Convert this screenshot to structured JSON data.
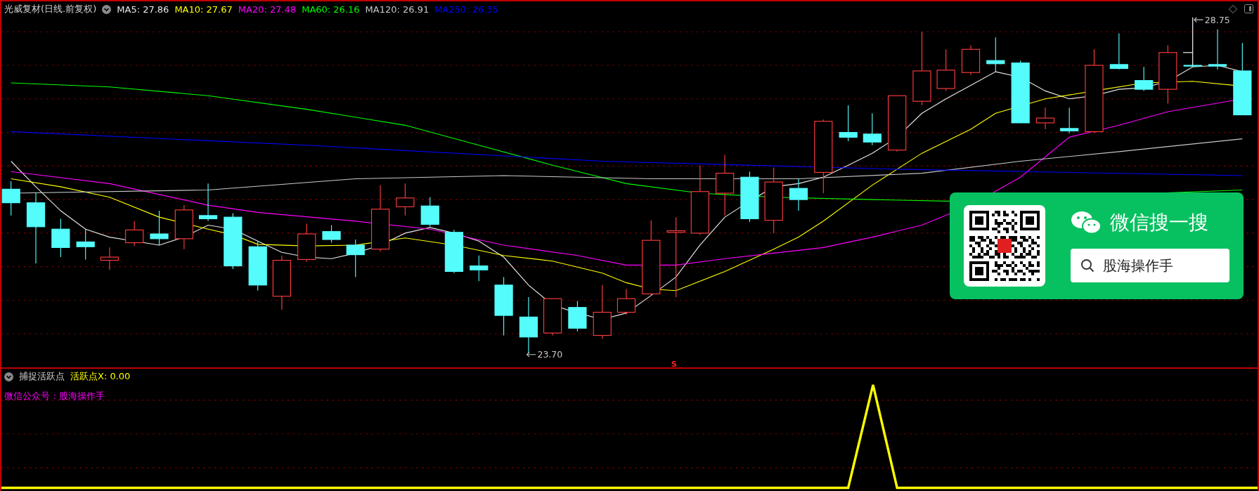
{
  "price_panel": {
    "title": "光威复材(日线.前复权)",
    "moving_averages": [
      {
        "label": "MA5: 27.86",
        "color": "#e8e8e8"
      },
      {
        "label": "MA10: 27.67",
        "color": "#ffff00"
      },
      {
        "label": "MA20: 27.48",
        "color": "#ff00ff"
      },
      {
        "label": "MA60: 26.16",
        "color": "#00ff00"
      },
      {
        "label": "MA120: 26.91",
        "color": "#c8c8c8"
      },
      {
        "label": "MA250: 26.35",
        "color": "#0000ff"
      }
    ],
    "high_label": "28.75",
    "low_label": "23.70",
    "signal_marker": "S"
  },
  "wechat_card": {
    "title": "微信搜一搜",
    "search_value": "股海操作手"
  },
  "indicator_panel": {
    "title": "捕捉活跃点",
    "value": "活跃点X: 0.00",
    "note": "微信公众号：股海操作手"
  }
}
